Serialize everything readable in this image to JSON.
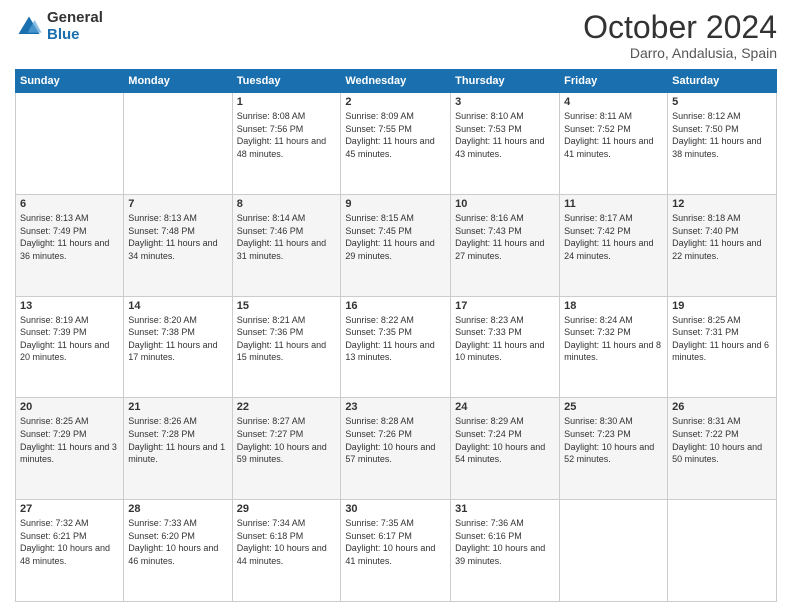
{
  "logo": {
    "general": "General",
    "blue": "Blue"
  },
  "header": {
    "month": "October 2024",
    "location": "Darro, Andalusia, Spain"
  },
  "days_of_week": [
    "Sunday",
    "Monday",
    "Tuesday",
    "Wednesday",
    "Thursday",
    "Friday",
    "Saturday"
  ],
  "weeks": [
    [
      {
        "day": "",
        "sunrise": "",
        "sunset": "",
        "daylight": ""
      },
      {
        "day": "",
        "sunrise": "",
        "sunset": "",
        "daylight": ""
      },
      {
        "day": "1",
        "sunrise": "Sunrise: 8:08 AM",
        "sunset": "Sunset: 7:56 PM",
        "daylight": "Daylight: 11 hours and 48 minutes."
      },
      {
        "day": "2",
        "sunrise": "Sunrise: 8:09 AM",
        "sunset": "Sunset: 7:55 PM",
        "daylight": "Daylight: 11 hours and 45 minutes."
      },
      {
        "day": "3",
        "sunrise": "Sunrise: 8:10 AM",
        "sunset": "Sunset: 7:53 PM",
        "daylight": "Daylight: 11 hours and 43 minutes."
      },
      {
        "day": "4",
        "sunrise": "Sunrise: 8:11 AM",
        "sunset": "Sunset: 7:52 PM",
        "daylight": "Daylight: 11 hours and 41 minutes."
      },
      {
        "day": "5",
        "sunrise": "Sunrise: 8:12 AM",
        "sunset": "Sunset: 7:50 PM",
        "daylight": "Daylight: 11 hours and 38 minutes."
      }
    ],
    [
      {
        "day": "6",
        "sunrise": "Sunrise: 8:13 AM",
        "sunset": "Sunset: 7:49 PM",
        "daylight": "Daylight: 11 hours and 36 minutes."
      },
      {
        "day": "7",
        "sunrise": "Sunrise: 8:13 AM",
        "sunset": "Sunset: 7:48 PM",
        "daylight": "Daylight: 11 hours and 34 minutes."
      },
      {
        "day": "8",
        "sunrise": "Sunrise: 8:14 AM",
        "sunset": "Sunset: 7:46 PM",
        "daylight": "Daylight: 11 hours and 31 minutes."
      },
      {
        "day": "9",
        "sunrise": "Sunrise: 8:15 AM",
        "sunset": "Sunset: 7:45 PM",
        "daylight": "Daylight: 11 hours and 29 minutes."
      },
      {
        "day": "10",
        "sunrise": "Sunrise: 8:16 AM",
        "sunset": "Sunset: 7:43 PM",
        "daylight": "Daylight: 11 hours and 27 minutes."
      },
      {
        "day": "11",
        "sunrise": "Sunrise: 8:17 AM",
        "sunset": "Sunset: 7:42 PM",
        "daylight": "Daylight: 11 hours and 24 minutes."
      },
      {
        "day": "12",
        "sunrise": "Sunrise: 8:18 AM",
        "sunset": "Sunset: 7:40 PM",
        "daylight": "Daylight: 11 hours and 22 minutes."
      }
    ],
    [
      {
        "day": "13",
        "sunrise": "Sunrise: 8:19 AM",
        "sunset": "Sunset: 7:39 PM",
        "daylight": "Daylight: 11 hours and 20 minutes."
      },
      {
        "day": "14",
        "sunrise": "Sunrise: 8:20 AM",
        "sunset": "Sunset: 7:38 PM",
        "daylight": "Daylight: 11 hours and 17 minutes."
      },
      {
        "day": "15",
        "sunrise": "Sunrise: 8:21 AM",
        "sunset": "Sunset: 7:36 PM",
        "daylight": "Daylight: 11 hours and 15 minutes."
      },
      {
        "day": "16",
        "sunrise": "Sunrise: 8:22 AM",
        "sunset": "Sunset: 7:35 PM",
        "daylight": "Daylight: 11 hours and 13 minutes."
      },
      {
        "day": "17",
        "sunrise": "Sunrise: 8:23 AM",
        "sunset": "Sunset: 7:33 PM",
        "daylight": "Daylight: 11 hours and 10 minutes."
      },
      {
        "day": "18",
        "sunrise": "Sunrise: 8:24 AM",
        "sunset": "Sunset: 7:32 PM",
        "daylight": "Daylight: 11 hours and 8 minutes."
      },
      {
        "day": "19",
        "sunrise": "Sunrise: 8:25 AM",
        "sunset": "Sunset: 7:31 PM",
        "daylight": "Daylight: 11 hours and 6 minutes."
      }
    ],
    [
      {
        "day": "20",
        "sunrise": "Sunrise: 8:25 AM",
        "sunset": "Sunset: 7:29 PM",
        "daylight": "Daylight: 11 hours and 3 minutes."
      },
      {
        "day": "21",
        "sunrise": "Sunrise: 8:26 AM",
        "sunset": "Sunset: 7:28 PM",
        "daylight": "Daylight: 11 hours and 1 minute."
      },
      {
        "day": "22",
        "sunrise": "Sunrise: 8:27 AM",
        "sunset": "Sunset: 7:27 PM",
        "daylight": "Daylight: 10 hours and 59 minutes."
      },
      {
        "day": "23",
        "sunrise": "Sunrise: 8:28 AM",
        "sunset": "Sunset: 7:26 PM",
        "daylight": "Daylight: 10 hours and 57 minutes."
      },
      {
        "day": "24",
        "sunrise": "Sunrise: 8:29 AM",
        "sunset": "Sunset: 7:24 PM",
        "daylight": "Daylight: 10 hours and 54 minutes."
      },
      {
        "day": "25",
        "sunrise": "Sunrise: 8:30 AM",
        "sunset": "Sunset: 7:23 PM",
        "daylight": "Daylight: 10 hours and 52 minutes."
      },
      {
        "day": "26",
        "sunrise": "Sunrise: 8:31 AM",
        "sunset": "Sunset: 7:22 PM",
        "daylight": "Daylight: 10 hours and 50 minutes."
      }
    ],
    [
      {
        "day": "27",
        "sunrise": "Sunrise: 7:32 AM",
        "sunset": "Sunset: 6:21 PM",
        "daylight": "Daylight: 10 hours and 48 minutes."
      },
      {
        "day": "28",
        "sunrise": "Sunrise: 7:33 AM",
        "sunset": "Sunset: 6:20 PM",
        "daylight": "Daylight: 10 hours and 46 minutes."
      },
      {
        "day": "29",
        "sunrise": "Sunrise: 7:34 AM",
        "sunset": "Sunset: 6:18 PM",
        "daylight": "Daylight: 10 hours and 44 minutes."
      },
      {
        "day": "30",
        "sunrise": "Sunrise: 7:35 AM",
        "sunset": "Sunset: 6:17 PM",
        "daylight": "Daylight: 10 hours and 41 minutes."
      },
      {
        "day": "31",
        "sunrise": "Sunrise: 7:36 AM",
        "sunset": "Sunset: 6:16 PM",
        "daylight": "Daylight: 10 hours and 39 minutes."
      },
      {
        "day": "",
        "sunrise": "",
        "sunset": "",
        "daylight": ""
      },
      {
        "day": "",
        "sunrise": "",
        "sunset": "",
        "daylight": ""
      }
    ]
  ]
}
